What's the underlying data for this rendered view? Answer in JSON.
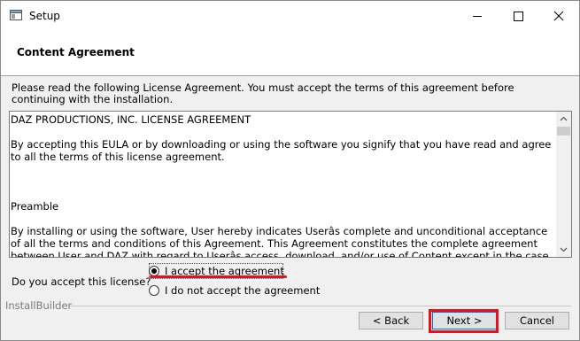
{
  "window": {
    "title": "Setup",
    "minimize_icon": "minimize-icon",
    "maximize_icon": "maximize-icon",
    "close_icon": "close-icon"
  },
  "header": {
    "title": "Content Agreement"
  },
  "intro_text": "Please read the following License Agreement. You must accept the terms of this agreement before continuing with the installation.",
  "license": {
    "lines": [
      "DAZ PRODUCTIONS, INC. LICENSE AGREEMENT",
      "",
      "By accepting this EULA or by downloading or using the software you signify that you have read and agree to all the terms of this license agreement.",
      "",
      "",
      "",
      "Preamble",
      "",
      "By installing or using the software, User hereby indicates Userâs complete and unconditional acceptance of all the terms and conditions of this Agreement. This Agreement constitutes the complete agreement between User and DAZ with regard to Userâs access, download, and/or use of Content except in the case"
    ]
  },
  "agreement": {
    "question": "Do you accept this license?",
    "options": [
      {
        "label": "I accept the agreement",
        "selected": true
      },
      {
        "label": "I do not accept the agreement",
        "selected": false
      }
    ]
  },
  "footer": {
    "brand": "InstallBuilder",
    "back_label": "< Back",
    "next_label": "Next >",
    "cancel_label": "Cancel"
  },
  "colors": {
    "highlight": "#e3101e",
    "focus_border": "#0078d7"
  }
}
